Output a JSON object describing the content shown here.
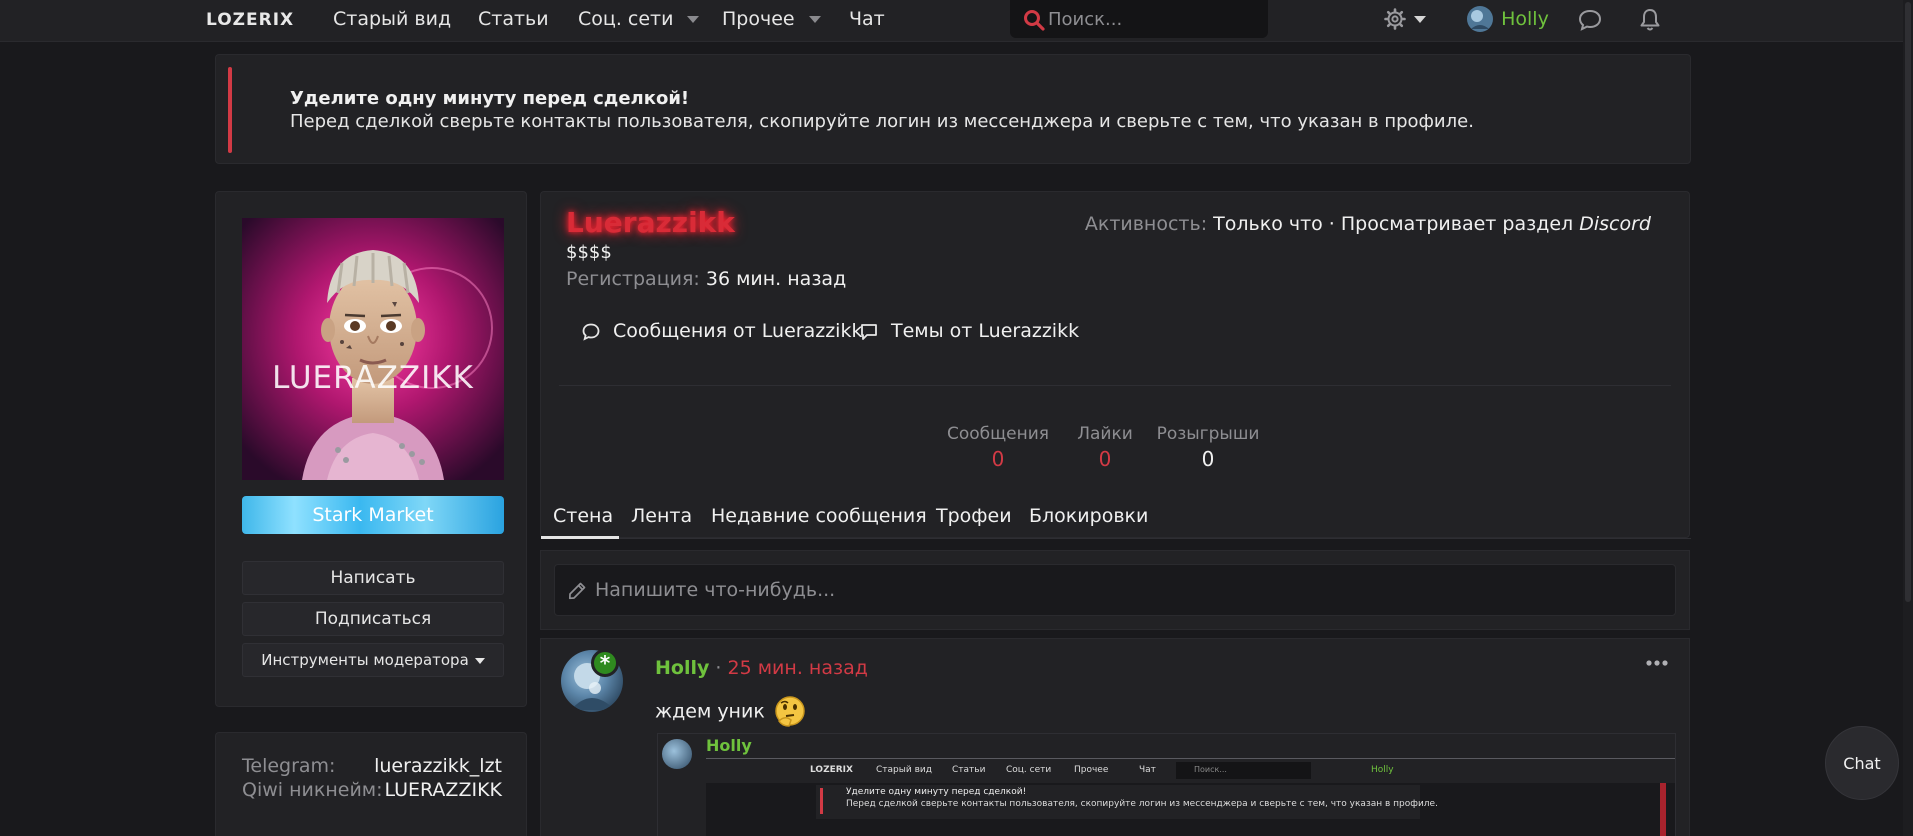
{
  "nav": {
    "logo": "LOZERIX",
    "items": [
      "Старый вид",
      "Статьи",
      "Соц. сети",
      "Прочее",
      "Чат"
    ],
    "search_placeholder": "Поиск...",
    "user": "Holly"
  },
  "notice": {
    "title": "Уделите одну минуту перед сделкой!",
    "text": "Перед сделкой сверьте контакты пользователя, скопируйте логин из мессенджера и сверьте с тем, что указан в профиле."
  },
  "profile": {
    "avatar_text": "LUERAZZIKK",
    "username": "Luerazzikk",
    "title_tag": "$$$$",
    "reg_label": "Регистрация:",
    "reg_value": "36 мин. назад",
    "activity_label": "Активность:",
    "activity_value": "Только что · Просматривает раздел",
    "activity_forum": "Discord",
    "links": [
      "Сообщения от Luerazzikk",
      "Темы от Luerazzikk"
    ],
    "stats": [
      {
        "label": "Сообщения",
        "value": "0",
        "color": "#d23a45"
      },
      {
        "label": "Лайки",
        "value": "0",
        "color": "#d23a45"
      },
      {
        "label": "Розыгрыши",
        "value": "0",
        "color": "#f0f0f0"
      }
    ],
    "stark_button": "Stark Market",
    "buttons": [
      "Написать",
      "Подписаться",
      "Инструменты модератора"
    ],
    "contacts": [
      {
        "label": "Telegram:",
        "value": "luerazzikk_lzt"
      },
      {
        "label": "Qiwi никнейм:",
        "value": "LUERAZZIKK"
      }
    ]
  },
  "tabs": [
    "Стена",
    "Лента",
    "Недавние сообщения",
    "Трофеи",
    "Блокировки"
  ],
  "write_placeholder": "Напишите что-нибудь...",
  "post": {
    "author": "Holly",
    "sep": " · ",
    "time": "25 мин. назад",
    "text": "ждем уник",
    "embedded": {
      "author": "Holly",
      "nav_logo": "LOZERIX",
      "nav_items": [
        "Старый вид",
        "Статьи",
        "Соц. сети",
        "Прочее",
        "Чат"
      ],
      "search": "Поиск...",
      "user": "Holly",
      "notice_title": "Уделите одну минуту перед сделкой!",
      "notice_text": "Перед сделкой сверьте контакты пользователя, скопируйте логин из мессенджера и сверьте с тем, что указан в профиле."
    }
  },
  "chat_button": "Chat",
  "colors": {
    "accent_red": "#d23a45",
    "user_green": "#6fc23d",
    "bg": "#19191c",
    "panel": "#222225"
  }
}
